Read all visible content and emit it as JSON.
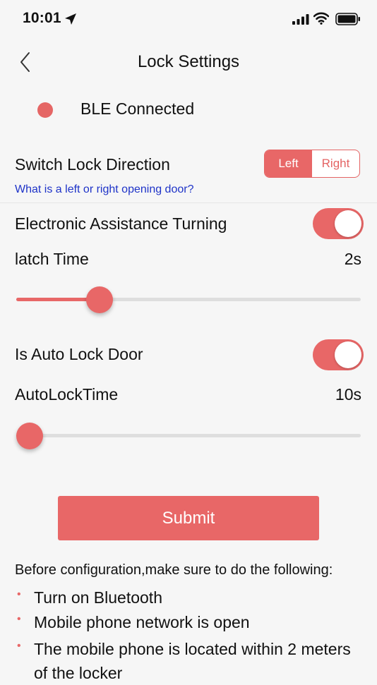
{
  "status_bar": {
    "time": "10:01"
  },
  "nav": {
    "title": "Lock Settings"
  },
  "connection": {
    "status": "BLE Connected",
    "dot_color": "#e56665"
  },
  "direction": {
    "label": "Switch Lock Direction",
    "help_link": "What is a left or right opening door?",
    "options": [
      "Left",
      "Right"
    ],
    "selected": "Left"
  },
  "assist": {
    "label": "Electronic Assistance Turning",
    "enabled": true
  },
  "latch": {
    "label": "latch Time",
    "value": "2s",
    "slider_fraction": 0.22
  },
  "auto_lock": {
    "label": "Is Auto Lock Door",
    "enabled": true
  },
  "auto_lock_time": {
    "label": "AutoLockTime",
    "value": "10s",
    "slider_fraction": 0.0
  },
  "submit": {
    "label": "Submit"
  },
  "notes": {
    "heading": "Before configuration,make sure to do the following:",
    "items": [
      "Turn on Bluetooth",
      "Mobile phone network is open",
      "The mobile phone is located within 2 meters of the locker"
    ]
  },
  "colors": {
    "accent": "#e86767",
    "link": "#1e33c8"
  }
}
